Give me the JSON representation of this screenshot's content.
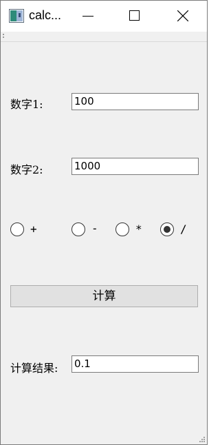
{
  "window": {
    "title": "calc..."
  },
  "form": {
    "num1_label": "数字1:",
    "num1_value": "100",
    "num2_label": "数字2:",
    "num2_value": "1000",
    "operators": [
      {
        "label": "+",
        "checked": false
      },
      {
        "label": "-",
        "checked": false
      },
      {
        "label": "*",
        "checked": false
      },
      {
        "label": "/",
        "checked": true
      }
    ],
    "compute_label": "计算",
    "result_label": "计算结果:",
    "result_value": "0.1"
  },
  "icons": {
    "app": "app-icon",
    "minimize": "minimize-icon",
    "maximize": "maximize-icon",
    "close": "close-icon"
  }
}
